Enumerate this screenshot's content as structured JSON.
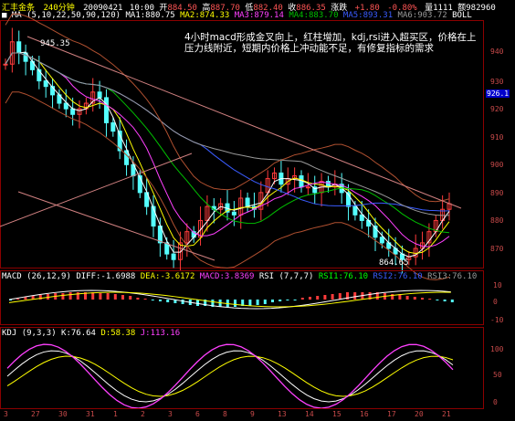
{
  "header": {
    "symbol": "汇丰金条",
    "period": "240分钟",
    "date": "20090421",
    "time": "10:00",
    "open_label": "开",
    "open": "884.50",
    "high_label": "高",
    "high": "887.70",
    "low_label": "低",
    "low": "882.40",
    "close_label": "收",
    "close": "886.35",
    "chg_label": "涨跌",
    "chg": "+1.80",
    "chg_pct": "-0.80%",
    "vol_label": "量",
    "vol": "1111",
    "amount_label": "额",
    "amount": "982960"
  },
  "ma_line": {
    "label": "MA",
    "params": "(5,10,22,50,90,120)",
    "ma1": "MA1:880.75",
    "ma2": "MA2:874.33",
    "ma3": "MA3:879.14",
    "ma4": "MA4:883.70",
    "ma5": "MA5:893.31",
    "ma6": "MA6:903.72",
    "boll": "BOLL"
  },
  "annotation": "4小时macd形成金叉向上，红柱增加，kdj,rsi进入超买区，价格在上压力线附近，短期内价格上冲动能不足，有修复指标的需求",
  "price_axis": [
    "940",
    "930",
    "920",
    "910",
    "900",
    "890",
    "880",
    "870"
  ],
  "current_price": "926.1",
  "high_mark": "945.35",
  "low_mark": "864.65",
  "macd_line": {
    "label": "MACD",
    "params": "(26,12,9)",
    "diff": "DIFF:-1.6988",
    "dea": "DEA:-3.6172",
    "macd": "MACD:3.8369",
    "rsi_label": "RSI",
    "rsi_params": "(7,7,7)",
    "rsi1": "RSI1:76.10",
    "rsi2": "RSI2:76.10",
    "rsi3": "RSI3:76.10"
  },
  "macd_axis": [
    "10",
    "0",
    "-10"
  ],
  "kdj_line": {
    "label": "KDJ",
    "params": "(9,3,3)",
    "k": "K:76.64",
    "d": "D:58.38",
    "j": "J:113.16"
  },
  "kdj_axis": [
    "100",
    "50",
    "0"
  ],
  "date_axis": [
    "3",
    "27",
    "30",
    "31",
    "1",
    "2",
    "3",
    "6",
    "8",
    "9",
    "13",
    "14",
    "15",
    "16",
    "17",
    "20",
    "21"
  ],
  "colors": {
    "up": "#ff3b3b",
    "down": "#54ffff",
    "ma_white": "#ffffff",
    "ma_yellow": "#ffff00",
    "ma_magenta": "#ff40ff",
    "ma_green": "#00c000",
    "ma_blue": "#3a5cff",
    "ma_gray": "#9a9a9a",
    "frame": "#8b0000"
  }
}
